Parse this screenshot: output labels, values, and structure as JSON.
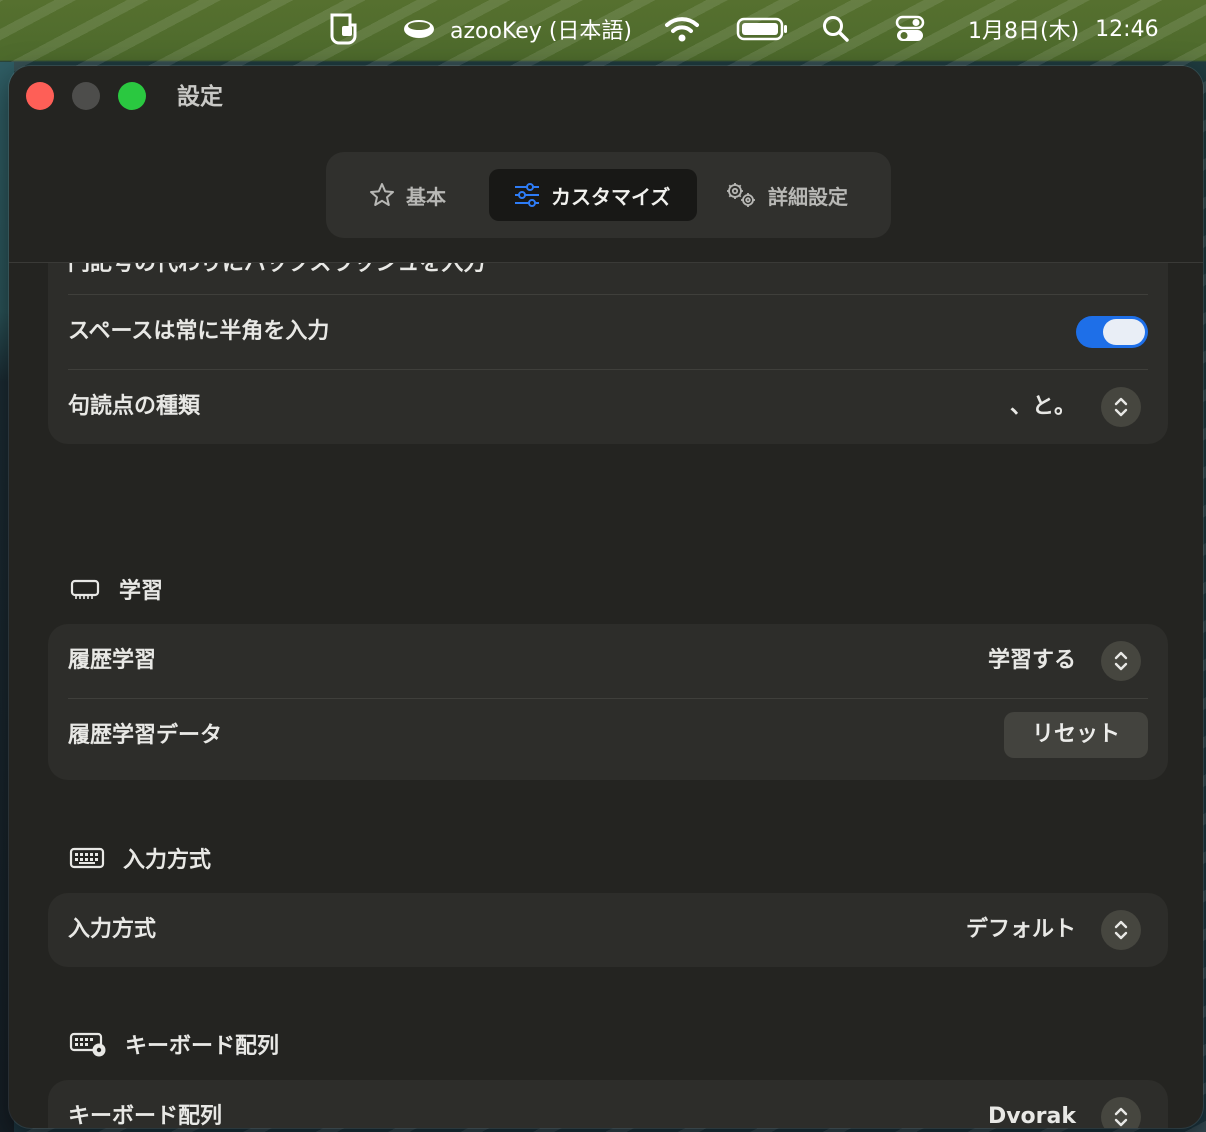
{
  "menubar": {
    "input_source": "azooKey (日本語)",
    "date": "1月8日(木)",
    "time": "12:46"
  },
  "window": {
    "title": "設定",
    "tabs": [
      {
        "label": "基本",
        "icon": "star-icon"
      },
      {
        "label": "カスタマイズ",
        "icon": "sliders-icon",
        "active": true
      },
      {
        "label": "詳細設定",
        "icon": "gears-icon"
      }
    ]
  },
  "section1": {
    "cutoff_label": "円記号の代わりにバックスラッシュを入力",
    "row_space": {
      "label": "スペースは常に半角を入力",
      "on": true
    },
    "row_punct": {
      "label": "句読点の種類",
      "value": "、と。"
    }
  },
  "learning": {
    "header": "学習",
    "row_history": {
      "label": "履歴学習",
      "value": "学習する"
    },
    "row_data": {
      "label": "履歴学習データ",
      "button": "リセット"
    }
  },
  "input_method": {
    "header": "入力方式",
    "row": {
      "label": "入力方式",
      "value": "デフォルト"
    }
  },
  "keyboard_layout": {
    "header": "キーボード配列",
    "row": {
      "label": "キーボード配列",
      "value": "Dvorak"
    }
  },
  "colors": {
    "accent": "#1e6fe8",
    "close": "#fe5f57",
    "maximize": "#2ac840"
  }
}
